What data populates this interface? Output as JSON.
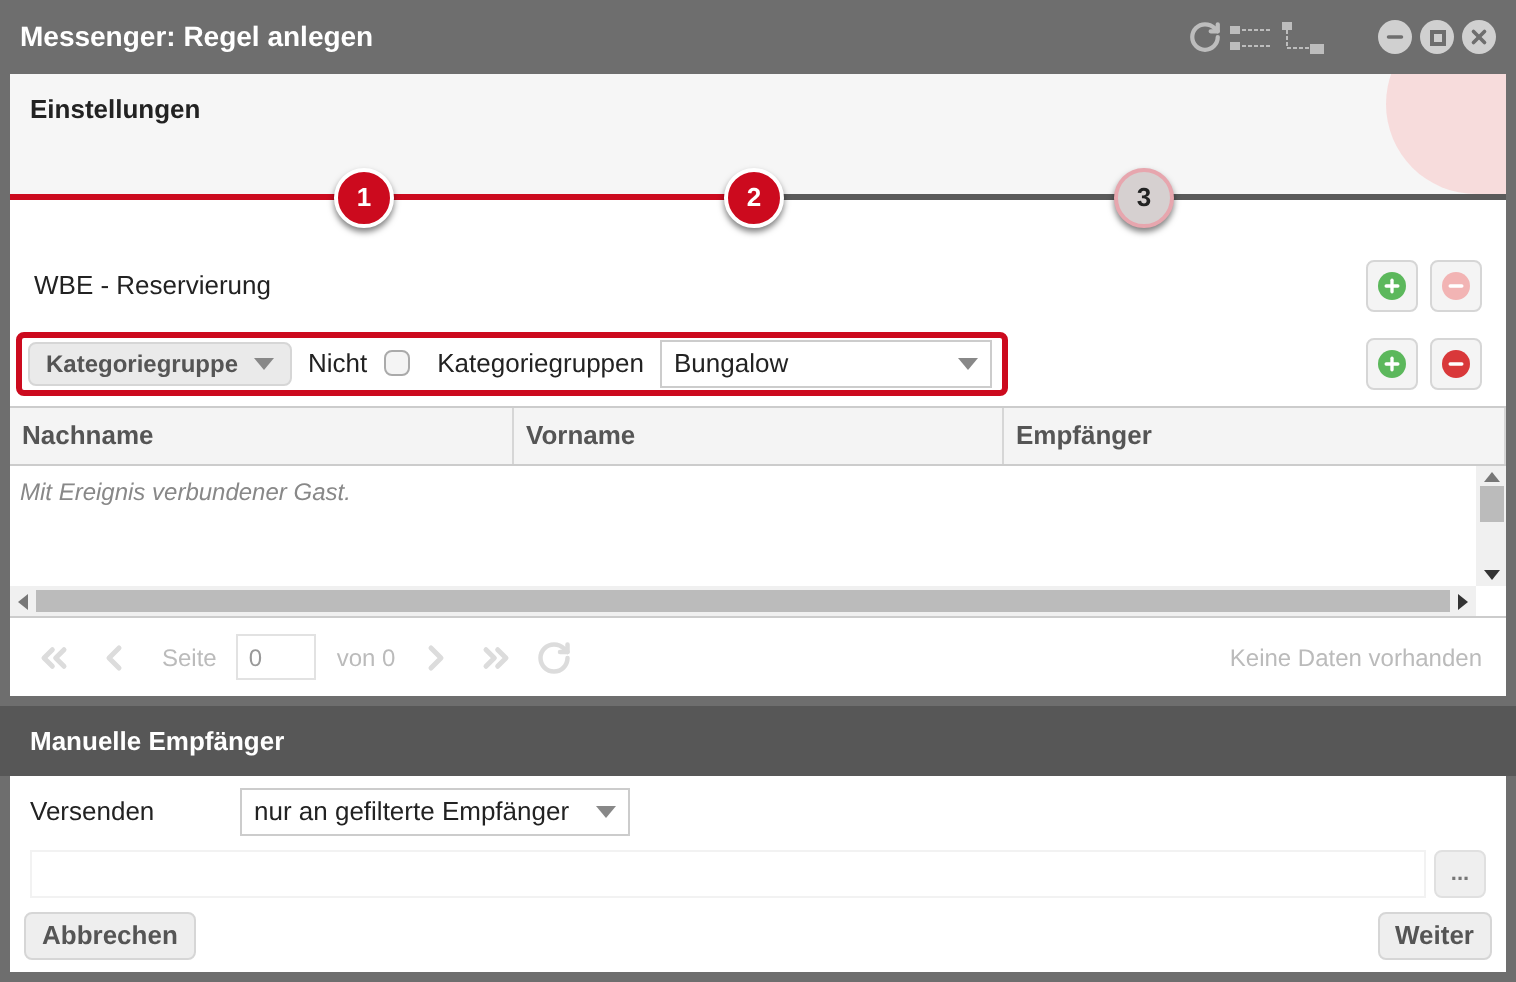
{
  "window": {
    "title": "Messenger: Regel anlegen"
  },
  "header": {
    "title": "Einstellungen"
  },
  "steps": [
    {
      "label": "1",
      "completed": true
    },
    {
      "label": "2",
      "completed": true
    },
    {
      "label": "3",
      "completed": false
    }
  ],
  "rule": {
    "label": "WBE - Reservierung",
    "add_disabled": false,
    "remove_disabled": true
  },
  "filter": {
    "type_button": "Kategoriegruppe",
    "not_label": "Nicht",
    "not_checked": false,
    "field_label": "Kategoriegruppen",
    "value": "Bungalow",
    "add_disabled": false,
    "remove_disabled": false
  },
  "table": {
    "columns": [
      "Nachname",
      "Vorname",
      "Empfänger"
    ],
    "empty_text": "Mit Ereignis verbundener Gast."
  },
  "pager": {
    "page_label": "Seite",
    "page_value": "0",
    "of_label": "von 0",
    "status": "Keine Daten vorhanden",
    "disabled": true
  },
  "manual": {
    "title": "Manuelle Empfänger",
    "send_label": "Versenden",
    "send_value": "nur an gefilterte Empfänger",
    "more_button": "..."
  },
  "buttons": {
    "cancel": "Abbrechen",
    "next": "Weiter"
  }
}
